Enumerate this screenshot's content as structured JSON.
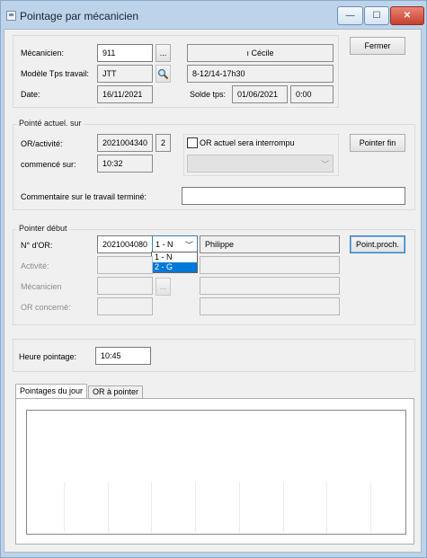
{
  "window": {
    "title": "Pointage par mécanicien"
  },
  "titlebar": {
    "min_label": "—",
    "max_label": "☐",
    "close_label": "✕"
  },
  "mecanicien": {
    "label": "Mécanicien:",
    "value": "911",
    "browse_label": "...",
    "name": "ı Cécile",
    "modele_label": "Modèle Tps travail:",
    "modele_value": "JTT",
    "horaire": "8-12/14-17h30",
    "date_label": "Date:",
    "date_value": "16/11/2021",
    "solde_label": "Solde tps:",
    "solde_date": "01/06/2021",
    "solde_value": "0:00",
    "fermer_label": "Fermer"
  },
  "pointe_actuel": {
    "title": "Pointé actuel. sur",
    "or_label": "OR/activité:",
    "or_value": "2021004340",
    "or_activity": "2",
    "interrompu_label": "OR actuel sera interrompu",
    "pointer_fin_label": "Pointer fin",
    "commence_label": "commencé sur:",
    "commence_value": "10:32",
    "commentaire_label": "Commentaire sur le travail terminé:",
    "commentaire_value": ""
  },
  "pointer_debut": {
    "title": "Pointer début",
    "nor_label": "N° d'OR:",
    "nor_value": "2021004080",
    "combo_selected": "1 - N",
    "options": [
      "1 - N",
      "2 - G"
    ],
    "client_name": "Philippe",
    "point_proch_label": "Point.proch.",
    "activite_label": "Activité:",
    "mecanicien_label": "Mécanicien",
    "mecanicien_browse": "...",
    "or_concerne_label": "OR concerné:"
  },
  "heure": {
    "label": "Heure pointage:",
    "value": "10:45"
  },
  "tabs": [
    {
      "label": "Pointages du jour",
      "active": true
    },
    {
      "label": "OR à pointer",
      "active": false
    }
  ],
  "colors": {
    "selection": "#0078d7",
    "frame": "#bcd3ea"
  }
}
